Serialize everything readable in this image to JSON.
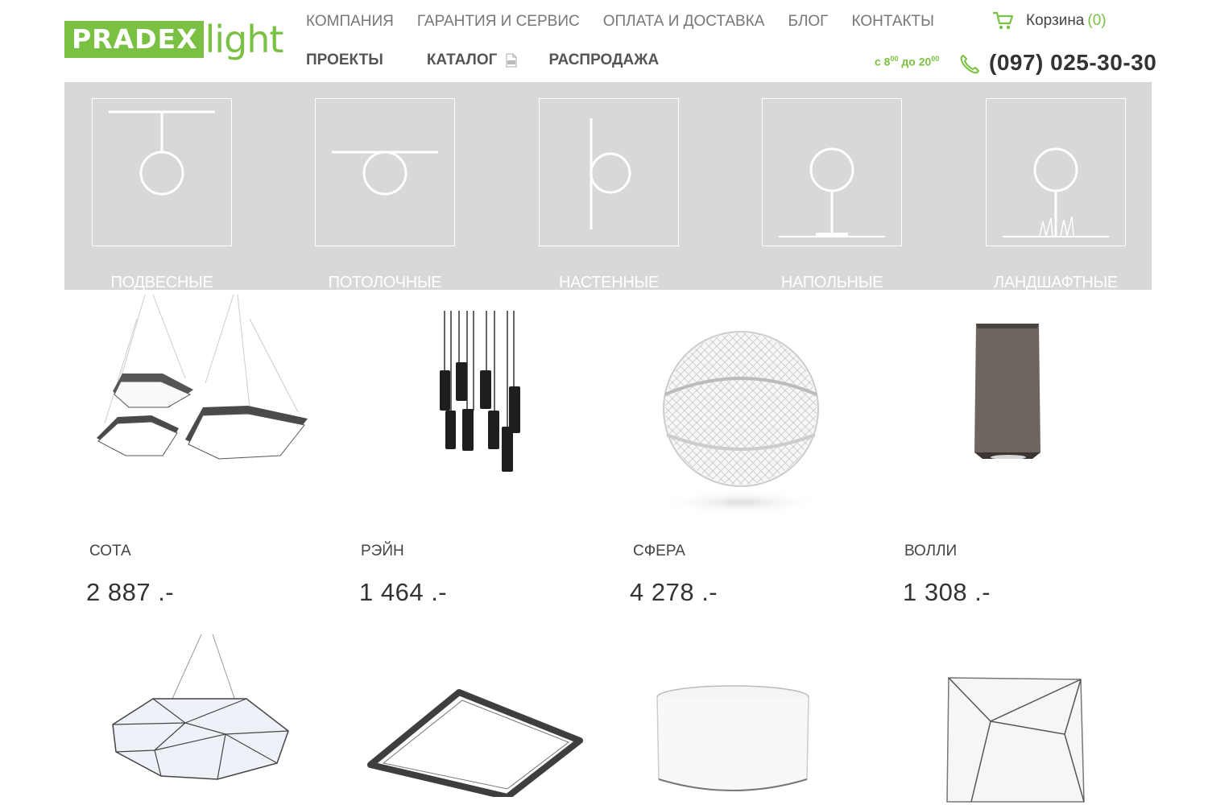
{
  "brand": {
    "logo_primary": "PRADEX",
    "logo_secondary": "light",
    "accent": "#7ac143"
  },
  "nav_top": [
    {
      "label": "КОМПАНИЯ"
    },
    {
      "label": "ГАРАНТИЯ И СЕРВИС"
    },
    {
      "label": "ОПЛАТА И ДОСТАВКА"
    },
    {
      "label": "БЛОГ"
    },
    {
      "label": "КОНТАКТЫ"
    }
  ],
  "nav_main": [
    {
      "label": "ПРОЕКТЫ"
    },
    {
      "label": "КАТАЛОГ",
      "icon": "pdf-icon"
    },
    {
      "label": "РАСПРОДАЖА"
    }
  ],
  "cart": {
    "label": "Корзина",
    "count": "(0)",
    "icon": "cart-icon"
  },
  "contact": {
    "hours_prefix": "с 8",
    "hours_start_sup": "00",
    "hours_mid": " до 20",
    "hours_end_sup": "00",
    "phone": "(097) 025-30-30",
    "icon": "phone-icon"
  },
  "categories": [
    {
      "label": "ПОДВЕСНЫЕ",
      "icon": "pendant-lamp-icon"
    },
    {
      "label": "ПОТОЛОЧНЫЕ",
      "icon": "ceiling-lamp-icon"
    },
    {
      "label": "НАСТЕННЫЕ",
      "icon": "wall-lamp-icon"
    },
    {
      "label": "НАПОЛЬНЫЕ",
      "icon": "floor-lamp-icon"
    },
    {
      "label": "ЛАНДШАФТНЫЕ",
      "icon": "landscape-lamp-icon"
    }
  ],
  "products": [
    {
      "name": "СОТА",
      "price": "2 887 .-"
    },
    {
      "name": "РЭЙН",
      "price": "1 464 .-"
    },
    {
      "name": "СФЕРА",
      "price": "4 278 .-"
    },
    {
      "name": "ВОЛЛИ",
      "price": "1 308 .-"
    }
  ]
}
